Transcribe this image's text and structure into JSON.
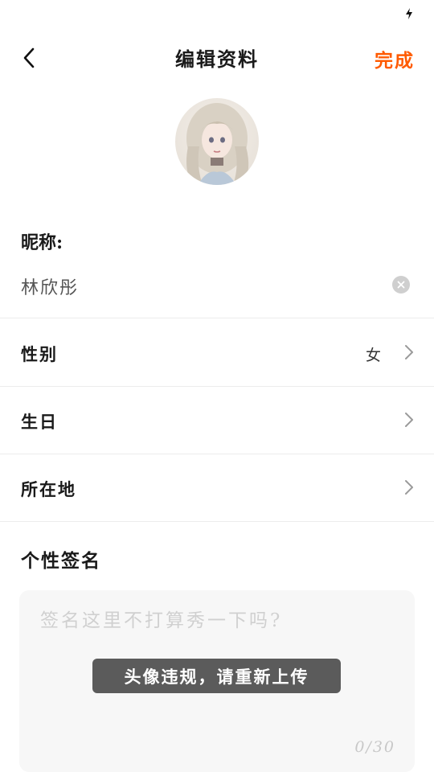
{
  "header": {
    "title": "编辑资料",
    "done_label": "完成"
  },
  "profile": {
    "nickname_label": "昵称",
    "nickname_colon": ":",
    "nickname_value": "林欣彤"
  },
  "rows": [
    {
      "label": "性别",
      "value": "女"
    },
    {
      "label": "生日",
      "value": ""
    },
    {
      "label": "所在地",
      "value": ""
    }
  ],
  "signature": {
    "title": "个性签名",
    "placeholder": "签名这里不打算秀一下吗?",
    "value": "",
    "count": "0/30"
  },
  "toast": {
    "message": "头像违规，请重新上传"
  },
  "colors": {
    "accent": "#ff5a00"
  },
  "icons": {
    "status": "charging-icon",
    "back": "back-arrow-icon",
    "clear": "clear-icon",
    "chevron": "chevron-right-icon"
  }
}
